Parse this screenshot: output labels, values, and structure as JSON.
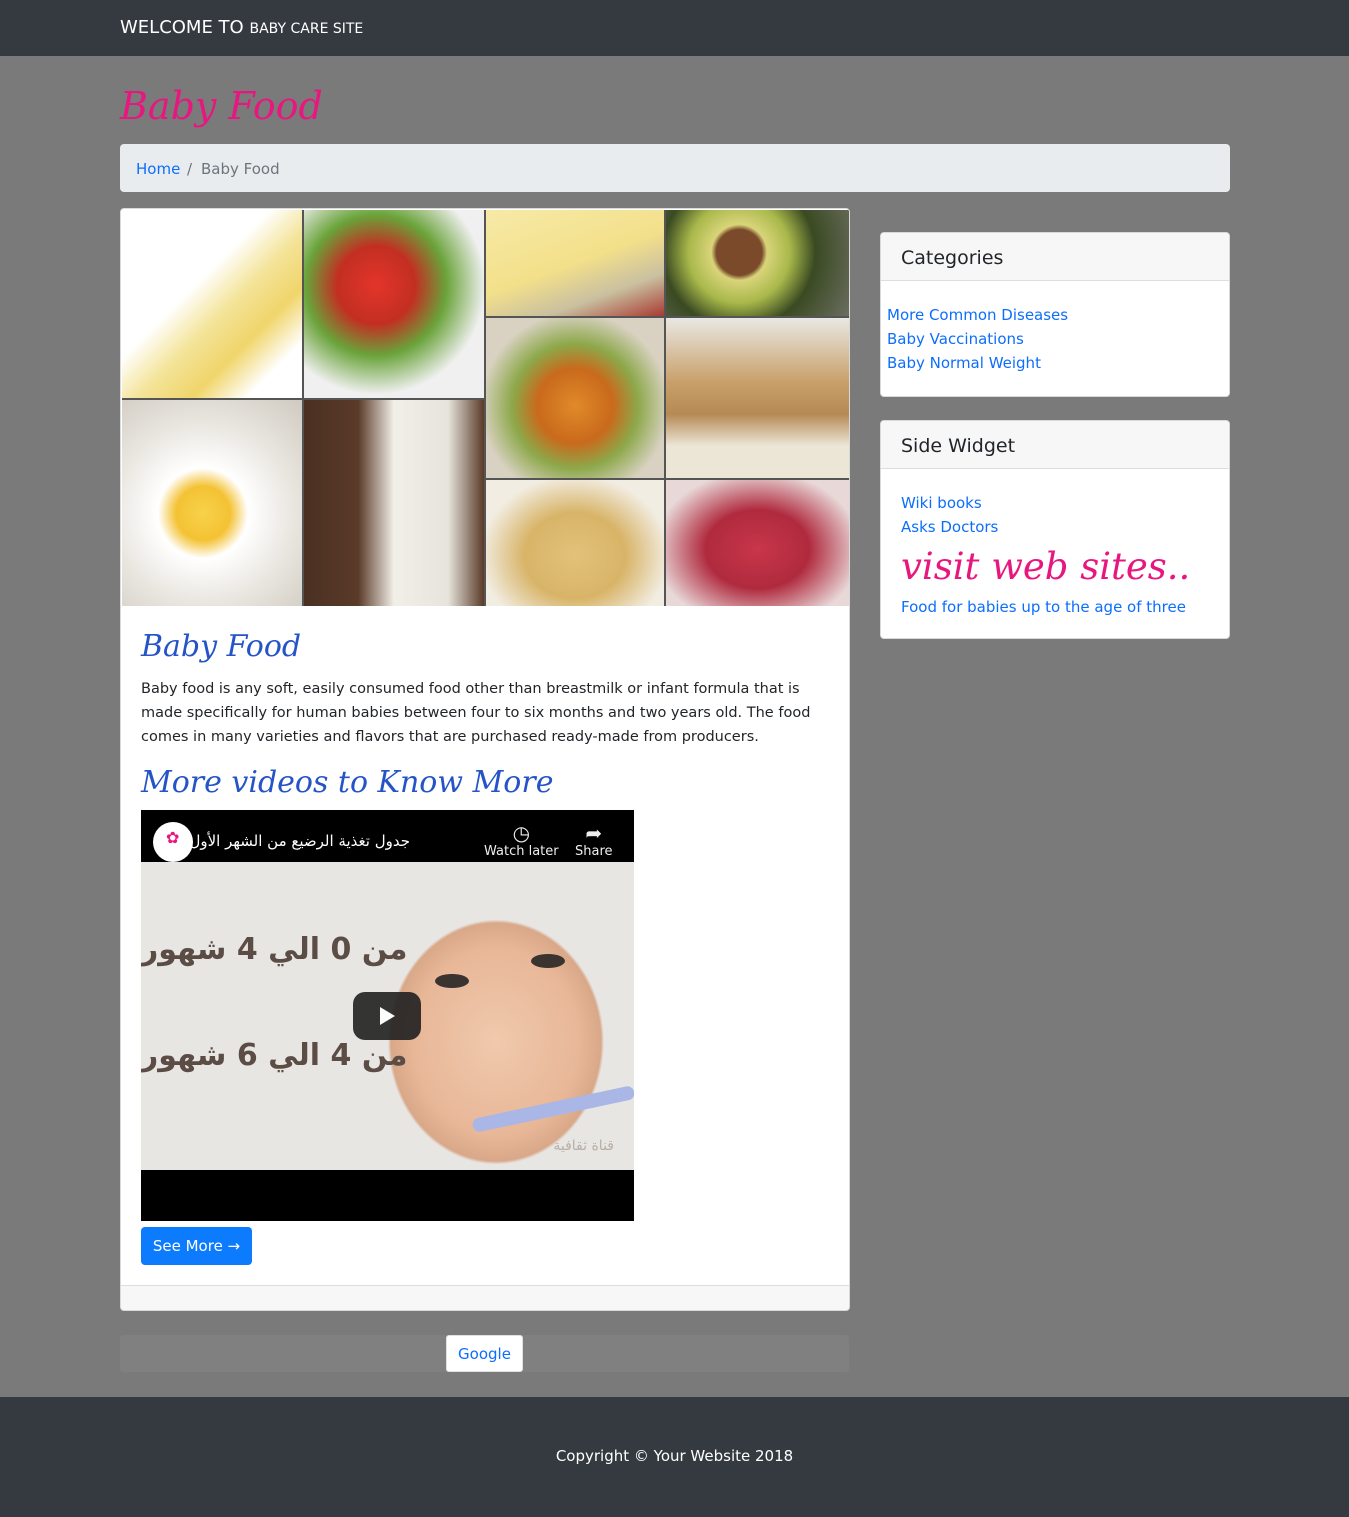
{
  "nav": {
    "brand_main": "WELCOME TO",
    "brand_sub": "BABY CARE SITE"
  },
  "page": {
    "title": "Baby Food"
  },
  "breadcrumb": {
    "home": "Home",
    "separator": "/",
    "current": "Baby Food"
  },
  "post": {
    "title": "Baby Food",
    "text": "Baby food is any soft, easily consumed food other than breastmilk or infant formula that is made specifically for human babies between four to six months and two years old. The food comes in many varieties and flavors that are purchased ready-made from producers.",
    "videos_heading": "More videos to Know More",
    "see_more": "See More →"
  },
  "video": {
    "title": "جدول تغذية الرضيع من الشهر الأول",
    "watch_later": "Watch later",
    "share": "Share",
    "overlay_line1": "من 0 الي 4 شهور",
    "overlay_line2": "من 4 الي 6 شهور",
    "watermark": "قناة ثقافية"
  },
  "pagination": {
    "google": "Google"
  },
  "categories": {
    "heading": "Categories",
    "items": [
      "More Common Diseases",
      "Baby Vaccinations",
      "Baby Normal Weight"
    ]
  },
  "side_widget": {
    "heading": "Side Widget",
    "links": [
      "Wiki books",
      "Asks Doctors"
    ],
    "visit": "visit web sites..",
    "food_link": "Food for babies up to the age of three"
  },
  "footer": {
    "copyright": "Copyright © Your Website 2018"
  },
  "colors": {
    "navbar": "#343a40",
    "background": "#7a7a7a",
    "accent_pink": "#e8177f",
    "heading_blue": "#2554c7",
    "link": "#0d6efd",
    "button": "#0d7bfd"
  }
}
